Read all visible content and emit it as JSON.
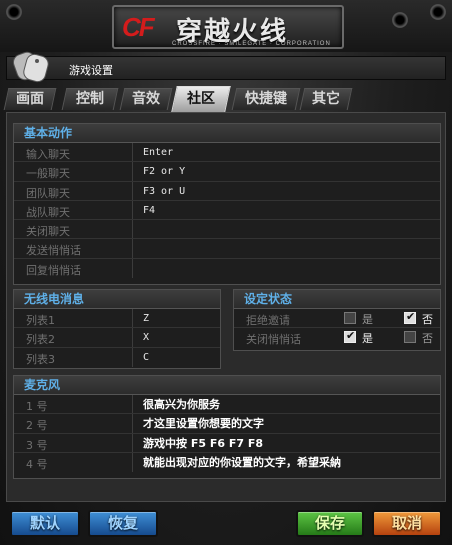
{
  "logo": {
    "cf": "CF",
    "cn": "穿越火线",
    "en": "CROSSFIRE · SMILEGATE · CORPORATION"
  },
  "window": {
    "title": "游戏设置"
  },
  "tabs": [
    {
      "label": "画面",
      "active": false
    },
    {
      "label": "控制",
      "active": false
    },
    {
      "label": "音效",
      "active": false
    },
    {
      "label": "社区",
      "active": true
    },
    {
      "label": "快捷键",
      "active": false
    },
    {
      "label": "其它",
      "active": false
    }
  ],
  "basic": {
    "heading": "基本动作",
    "rows": [
      {
        "label": "输入聊天",
        "value": "Enter"
      },
      {
        "label": "一般聊天",
        "value": "F2 or Y"
      },
      {
        "label": "团队聊天",
        "value": "F3 or U"
      },
      {
        "label": "战队聊天",
        "value": "F4"
      },
      {
        "label": "关闭聊天",
        "value": ""
      },
      {
        "label": "发送悄悄话",
        "value": ""
      },
      {
        "label": "回复悄悄话",
        "value": ""
      }
    ]
  },
  "radio": {
    "heading": "无线电消息",
    "rows": [
      {
        "label": "列表1",
        "value": "Z"
      },
      {
        "label": "列表2",
        "value": "X"
      },
      {
        "label": "列表3",
        "value": "C"
      }
    ]
  },
  "status": {
    "heading": "设定状态",
    "yes_label": "是",
    "no_label": "否",
    "rows": [
      {
        "label": "拒绝邀请",
        "yes": false,
        "no": true
      },
      {
        "label": "关闭悄悄话",
        "yes": true,
        "no": false
      }
    ]
  },
  "mic": {
    "heading": "麦克风",
    "rows": [
      {
        "label": "1 号",
        "value": "很高兴为你服务"
      },
      {
        "label": "2 号",
        "value": "才这里设置你想要的文字"
      },
      {
        "label": "3 号",
        "value": "游戏中按 F5  F6  F7  F8"
      },
      {
        "label": "4 号",
        "value": "就能出现对应的你设置的文字，希望采納"
      }
    ]
  },
  "buttons": {
    "default": "默认",
    "restore": "恢复",
    "save": "保存",
    "cancel": "取消"
  },
  "colors": {
    "heading_blue": "#5fb0e8",
    "btn_blue": "#1f5fa8",
    "btn_green": "#3a9a28",
    "btn_orange": "#d0651f"
  }
}
